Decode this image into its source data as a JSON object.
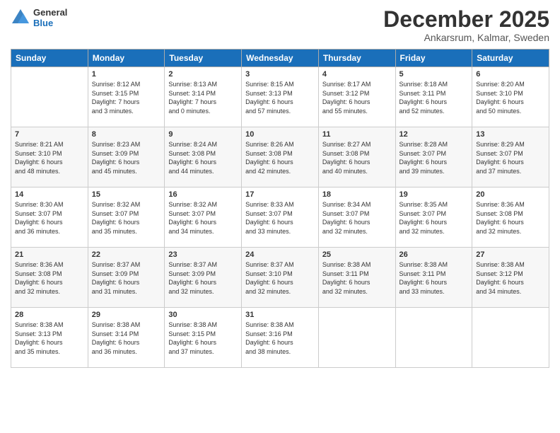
{
  "header": {
    "logo_general": "General",
    "logo_blue": "Blue",
    "month": "December 2025",
    "location": "Ankarsrum, Kalmar, Sweden"
  },
  "days_of_week": [
    "Sunday",
    "Monday",
    "Tuesday",
    "Wednesday",
    "Thursday",
    "Friday",
    "Saturday"
  ],
  "weeks": [
    [
      {
        "day": "",
        "info": ""
      },
      {
        "day": "1",
        "info": "Sunrise: 8:12 AM\nSunset: 3:15 PM\nDaylight: 7 hours\nand 3 minutes."
      },
      {
        "day": "2",
        "info": "Sunrise: 8:13 AM\nSunset: 3:14 PM\nDaylight: 7 hours\nand 0 minutes."
      },
      {
        "day": "3",
        "info": "Sunrise: 8:15 AM\nSunset: 3:13 PM\nDaylight: 6 hours\nand 57 minutes."
      },
      {
        "day": "4",
        "info": "Sunrise: 8:17 AM\nSunset: 3:12 PM\nDaylight: 6 hours\nand 55 minutes."
      },
      {
        "day": "5",
        "info": "Sunrise: 8:18 AM\nSunset: 3:11 PM\nDaylight: 6 hours\nand 52 minutes."
      },
      {
        "day": "6",
        "info": "Sunrise: 8:20 AM\nSunset: 3:10 PM\nDaylight: 6 hours\nand 50 minutes."
      }
    ],
    [
      {
        "day": "7",
        "info": "Sunrise: 8:21 AM\nSunset: 3:10 PM\nDaylight: 6 hours\nand 48 minutes."
      },
      {
        "day": "8",
        "info": "Sunrise: 8:23 AM\nSunset: 3:09 PM\nDaylight: 6 hours\nand 45 minutes."
      },
      {
        "day": "9",
        "info": "Sunrise: 8:24 AM\nSunset: 3:08 PM\nDaylight: 6 hours\nand 44 minutes."
      },
      {
        "day": "10",
        "info": "Sunrise: 8:26 AM\nSunset: 3:08 PM\nDaylight: 6 hours\nand 42 minutes."
      },
      {
        "day": "11",
        "info": "Sunrise: 8:27 AM\nSunset: 3:08 PM\nDaylight: 6 hours\nand 40 minutes."
      },
      {
        "day": "12",
        "info": "Sunrise: 8:28 AM\nSunset: 3:07 PM\nDaylight: 6 hours\nand 39 minutes."
      },
      {
        "day": "13",
        "info": "Sunrise: 8:29 AM\nSunset: 3:07 PM\nDaylight: 6 hours\nand 37 minutes."
      }
    ],
    [
      {
        "day": "14",
        "info": "Sunrise: 8:30 AM\nSunset: 3:07 PM\nDaylight: 6 hours\nand 36 minutes."
      },
      {
        "day": "15",
        "info": "Sunrise: 8:32 AM\nSunset: 3:07 PM\nDaylight: 6 hours\nand 35 minutes."
      },
      {
        "day": "16",
        "info": "Sunrise: 8:32 AM\nSunset: 3:07 PM\nDaylight: 6 hours\nand 34 minutes."
      },
      {
        "day": "17",
        "info": "Sunrise: 8:33 AM\nSunset: 3:07 PM\nDaylight: 6 hours\nand 33 minutes."
      },
      {
        "day": "18",
        "info": "Sunrise: 8:34 AM\nSunset: 3:07 PM\nDaylight: 6 hours\nand 32 minutes."
      },
      {
        "day": "19",
        "info": "Sunrise: 8:35 AM\nSunset: 3:07 PM\nDaylight: 6 hours\nand 32 minutes."
      },
      {
        "day": "20",
        "info": "Sunrise: 8:36 AM\nSunset: 3:08 PM\nDaylight: 6 hours\nand 32 minutes."
      }
    ],
    [
      {
        "day": "21",
        "info": "Sunrise: 8:36 AM\nSunset: 3:08 PM\nDaylight: 6 hours\nand 32 minutes."
      },
      {
        "day": "22",
        "info": "Sunrise: 8:37 AM\nSunset: 3:09 PM\nDaylight: 6 hours\nand 31 minutes."
      },
      {
        "day": "23",
        "info": "Sunrise: 8:37 AM\nSunset: 3:09 PM\nDaylight: 6 hours\nand 32 minutes."
      },
      {
        "day": "24",
        "info": "Sunrise: 8:37 AM\nSunset: 3:10 PM\nDaylight: 6 hours\nand 32 minutes."
      },
      {
        "day": "25",
        "info": "Sunrise: 8:38 AM\nSunset: 3:11 PM\nDaylight: 6 hours\nand 32 minutes."
      },
      {
        "day": "26",
        "info": "Sunrise: 8:38 AM\nSunset: 3:11 PM\nDaylight: 6 hours\nand 33 minutes."
      },
      {
        "day": "27",
        "info": "Sunrise: 8:38 AM\nSunset: 3:12 PM\nDaylight: 6 hours\nand 34 minutes."
      }
    ],
    [
      {
        "day": "28",
        "info": "Sunrise: 8:38 AM\nSunset: 3:13 PM\nDaylight: 6 hours\nand 35 minutes."
      },
      {
        "day": "29",
        "info": "Sunrise: 8:38 AM\nSunset: 3:14 PM\nDaylight: 6 hours\nand 36 minutes."
      },
      {
        "day": "30",
        "info": "Sunrise: 8:38 AM\nSunset: 3:15 PM\nDaylight: 6 hours\nand 37 minutes."
      },
      {
        "day": "31",
        "info": "Sunrise: 8:38 AM\nSunset: 3:16 PM\nDaylight: 6 hours\nand 38 minutes."
      },
      {
        "day": "",
        "info": ""
      },
      {
        "day": "",
        "info": ""
      },
      {
        "day": "",
        "info": ""
      }
    ]
  ]
}
